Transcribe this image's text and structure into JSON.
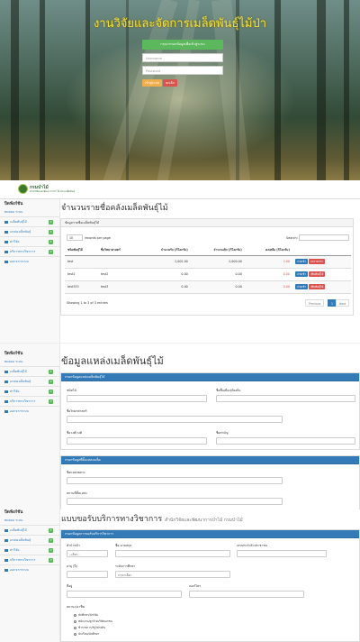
{
  "login": {
    "title": "งานวิจัยและจัดการเมล็ดพันธุ์ไม้ป่า",
    "header": "กรุณากรอกข้อมูลเพื่อเข้าสู่ระบบ",
    "username_placeholder": "Username",
    "password_placeholder": "Password",
    "login_label": "เข้าสู่ระบบ",
    "cancel_label": "ยกเลิก",
    "colors": {
      "green": "#5cb85c",
      "orange": "#f0ad4e",
      "red": "#d9534f",
      "title": "#f4e23a"
    }
  },
  "brand": {
    "name": "กรมป่าไม้",
    "sub": "สำนักวิจัยและพัฒนาการป่าไม้ ส่วนเมล็ดพันธุ์"
  },
  "sidebar": {
    "heading": "ปิดฟังก์ชัน",
    "user": "ทดสอบ ระบบ",
    "items": [
      {
        "label": "เมล็ดพันธุ์ไม้",
        "badge": "3",
        "icon": "table-icon"
      },
      {
        "label": "แหล่งเมล็ดพันธุ์",
        "badge": "3",
        "icon": "table-icon"
      },
      {
        "label": "ค่าวิจัย",
        "badge": "3",
        "icon": "grid-icon"
      },
      {
        "label": "บริการทางวิชาการ",
        "badge": "3",
        "icon": "list-icon"
      },
      {
        "label": "ออกจากระบบ",
        "badge": "",
        "icon": "logout-icon"
      }
    ]
  },
  "inventory": {
    "title": "จำนวนรายชื่อคลังเมล็ดพันธุ์ไม้",
    "panel_title": "ข้อมูลรายชื่อเมล็ดพันธุ์ไม้",
    "page_size": "10",
    "records_label": "records per page",
    "search_label": "Search:",
    "columns": [
      "ชนิดพันธุ์ไม้",
      "ชื่อวิทยาศาสตร์",
      "จำนวนรับ (กิโลกรัม)",
      "จำนวนเบิก (กิโลกรัม)",
      "คงเหลือ (กิโลกรัม)",
      ""
    ],
    "rows": [
      {
        "name": "test",
        "sci": "",
        "recv": "2,002.00",
        "out": "2,000.00",
        "left": "2.00",
        "b1": "จ่ายเข้า",
        "b2": "ลบรายการ"
      },
      {
        "name": "test2",
        "sci": "test2",
        "recv": "0.00",
        "out": "0.00",
        "left": "0.00",
        "b1": "จ่ายเข้า",
        "b2": "เพิ่มพันธุ์ไม้"
      },
      {
        "name": "test333",
        "sci": "test3",
        "recv": "0.00",
        "out": "0.00",
        "left": "0.00",
        "b1": "จ่ายเข้า",
        "b2": "เพิ่มพันธุ์ไม้"
      }
    ],
    "showing": "Showing 1 to 3 of 3 entries",
    "prev": "Previous",
    "page": "1",
    "next": "Next"
  },
  "source": {
    "title": "ข้อมูลแหล่งเมล็ดพันธุ์ไม้",
    "panel1": "กรอกข้อมูลแหล่งเมล็ดพันธุ์ไม้",
    "f_name": "ชนิดไม้",
    "f_local": "ชื่อพื้นเมือง/ท้องถิ่น",
    "f_sci": "ชื่อวิทยาศาสตร์",
    "f_family": "ชื่อวงศ์/วงศ์",
    "f_code": "ชื่อสามัญ",
    "panel2": "กรอกข้อมูลที่ตั้งแหล่งเมล็ด",
    "f_place": "ชื่อแหล่งพลาง",
    "f_area": "สถานที่ตั้งแหล่ง"
  },
  "service": {
    "title": "แบบขอรับบริการทางวิชาการ",
    "subtitle": "สำนักวิจัยและพัฒนาการป่าไม้ กรมป่าไม้",
    "panel": "กรอกข้อมูลการขอรับบริการวิชาการ",
    "f_prefix": "คำนำหน้า",
    "prefix_value": "--เลือก--",
    "f_name": "ชื่อ-นามสกุล",
    "f_idcard": "เลขประจำตัวประชาชน",
    "f_age": "อายุ (ปี)",
    "f_edu": "ระดับการศึกษา",
    "edu_value": "กรุณาเลือก",
    "f_addr": "ที่อยู่",
    "f_phone": "เบอร์โทร",
    "f_occ": "สถานะ/อาชีพ",
    "occupations": [
      "นักศึกษา/นักวิจัย",
      "พนักงาน/ลูกจ้างบริษัทเอกชน",
      "ข้าราชการ/รัฐวิสาหกิจ",
      "นักเรียน/นักศึกษา"
    ]
  }
}
